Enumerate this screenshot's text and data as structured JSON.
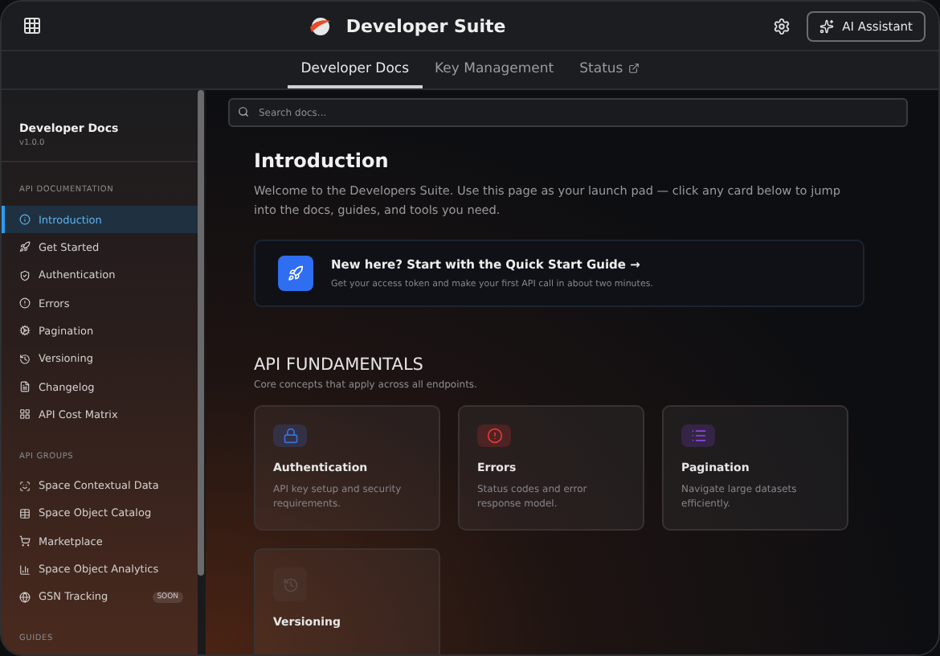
{
  "header": {
    "title": "Developer Suite",
    "assistant_button": "AI Assistant"
  },
  "tabs": [
    {
      "label": "Developer Docs",
      "selected": true,
      "external": false
    },
    {
      "label": "Key Management",
      "selected": false,
      "external": false
    },
    {
      "label": "Status",
      "selected": false,
      "external": true
    }
  ],
  "sidebar": {
    "title": "Developer Docs",
    "version": "v1.0.0",
    "sections": [
      {
        "heading": "API DOCUMENTATION",
        "items": [
          {
            "label": "Introduction",
            "selected": true
          },
          {
            "label": "Get Started",
            "selected": false
          },
          {
            "label": "Authentication",
            "selected": false
          },
          {
            "label": "Errors",
            "selected": false
          },
          {
            "label": "Pagination",
            "selected": false
          },
          {
            "label": "Versioning",
            "selected": false
          },
          {
            "label": "Changelog",
            "selected": false
          },
          {
            "label": "API Cost Matrix",
            "selected": false
          }
        ]
      },
      {
        "heading": "API GROUPS",
        "items": [
          {
            "label": "Space Contextual Data",
            "selected": false
          },
          {
            "label": "Space Object Catalog",
            "selected": false
          },
          {
            "label": "Marketplace",
            "selected": false
          },
          {
            "label": "Space Object Analytics",
            "selected": false
          },
          {
            "label": "GSN Tracking",
            "selected": false,
            "badge": "SOON"
          }
        ]
      },
      {
        "heading": "GUIDES"
      }
    ]
  },
  "search": {
    "placeholder": "Search docs..."
  },
  "intro": {
    "title": "Introduction",
    "text": "Welcome to the Developers Suite. Use this page as your launch pad — click any card below to jump into the docs, guides, and tools you need."
  },
  "quick_start": {
    "title": "New here? Start with the Quick Start Guide →",
    "text": "Get your access token and make your first API call in about two minutes."
  },
  "fundamentals": {
    "title": "API FUNDAMENTALS",
    "subtitle": "Core concepts that apply across all endpoints.",
    "cards": [
      {
        "title": "Authentication",
        "text": "API key setup and security requirements.",
        "color": "#3b6fe0"
      },
      {
        "title": "Errors",
        "text": "Status codes and error response model.",
        "color": "#e53935"
      },
      {
        "title": "Pagination",
        "text": "Navigate large datasets efficiently.",
        "color": "#8e44e8"
      },
      {
        "title": "Versioning",
        "color": "#5a4a46"
      }
    ]
  }
}
